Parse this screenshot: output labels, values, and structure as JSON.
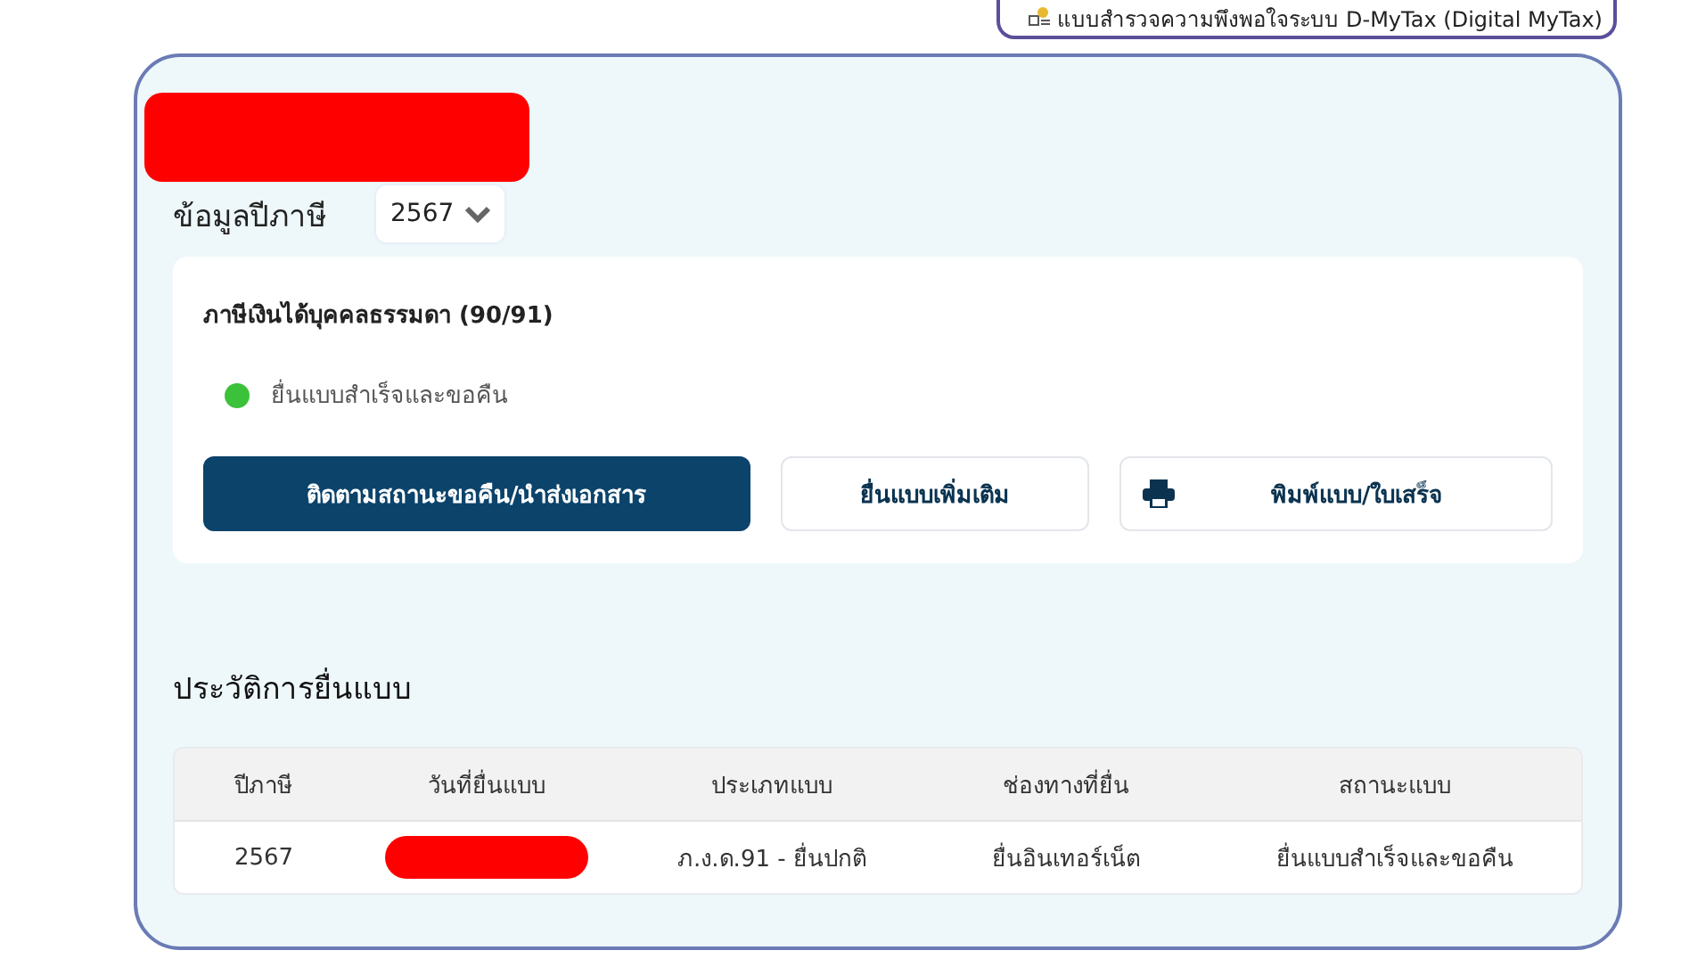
{
  "survey_link": {
    "label": "แบบสำรวจความพึงพอใจระบบ D-MyTax (Digital MyTax)"
  },
  "tax_year": {
    "label": "ข้อมูลปีภาษี",
    "value": "2567"
  },
  "summary": {
    "title": "ภาษีเงินได้บุคคลธรรมดา (90/91)",
    "status": {
      "label": "ยื่นแบบสำเร็จและขอคืน",
      "color": "#3cc13b"
    },
    "buttons": [
      {
        "label": "ติดตามสถานะขอคืน/นำส่งเอกสาร",
        "kind": "primary"
      },
      {
        "label": "ยื่นแบบเพิ่มเติม",
        "kind": "secondary"
      },
      {
        "label": "พิมพ์แบบ/ใบเสร็จ",
        "kind": "print"
      }
    ]
  },
  "history": {
    "title": "ประวัติการยื่นแบบ",
    "columns": [
      "ปีภาษี",
      "วันที่ยื่นแบบ",
      "ประเภทแบบ",
      "ช่องทางที่ยื่น",
      "สถานะแบบ"
    ],
    "rows": [
      {
        "cells": [
          "2567",
          null,
          "ภ.ง.ด.91 - ยื่นปกติ",
          "ยื่นอินเทอร์เน็ต",
          "ยื่นแบบสำเร็จและขอคืน"
        ]
      }
    ]
  }
}
